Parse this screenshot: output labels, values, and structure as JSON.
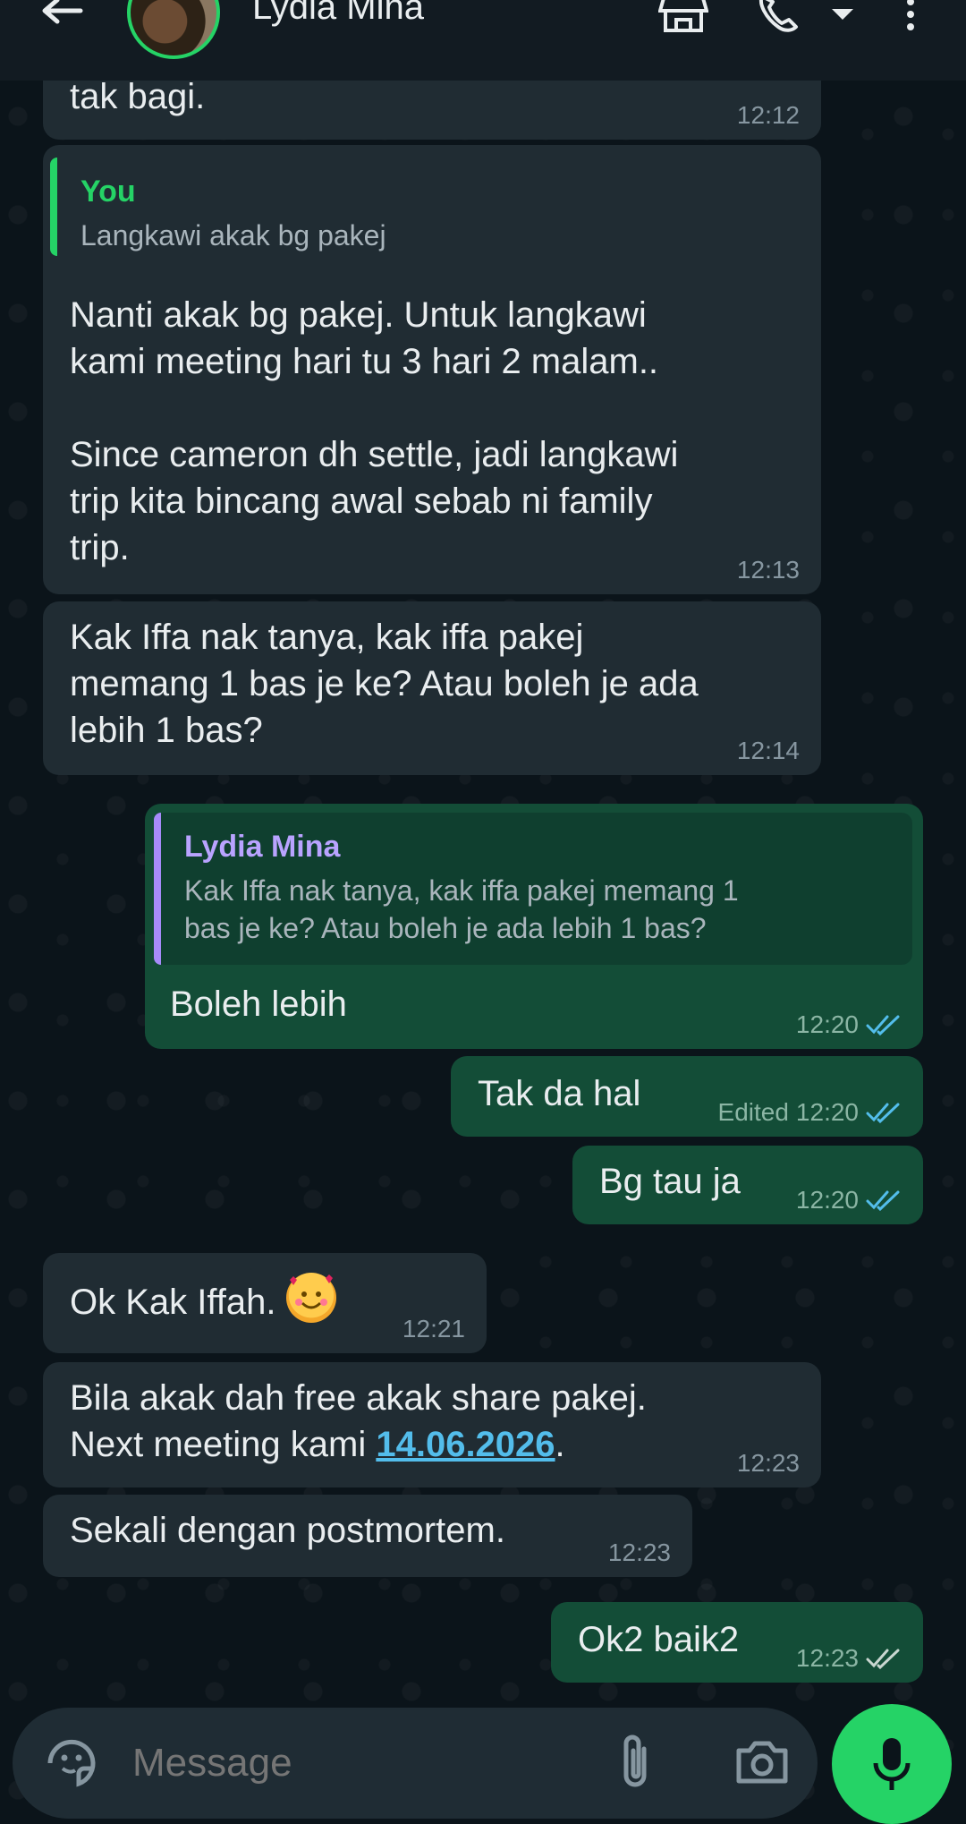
{
  "header": {
    "contact_name": "Lydia Mina"
  },
  "messages": [
    {
      "id": "m1",
      "direction": "in",
      "text": "tak bagi.",
      "time": "12:12"
    },
    {
      "id": "m2",
      "direction": "in",
      "quote": {
        "name": "You",
        "text": "Langkawi akak bg pakej"
      },
      "text": "Nanti akak bg pakej. Untuk langkawi\nkami meeting hari tu 3 hari 2 malam..\n\nSince cameron dh settle, jadi langkawi\ntrip kita bincang awal sebab ni family\ntrip.",
      "time": "12:13"
    },
    {
      "id": "m3",
      "direction": "in",
      "text": "Kak Iffa nak tanya, kak iffa pakej\nmemang 1 bas je ke? Atau boleh je ada\nlebih 1 bas?",
      "time": "12:14"
    },
    {
      "id": "m4",
      "direction": "out",
      "quote": {
        "name": "Lydia Mina",
        "text": "Kak Iffa nak tanya, kak iffa pakej memang 1\nbas je ke? Atau boleh je ada lebih 1 bas?"
      },
      "text": "Boleh lebih",
      "time": "12:20"
    },
    {
      "id": "m5",
      "direction": "out",
      "text": "Tak da hal",
      "edited": "Edited",
      "time": "12:20"
    },
    {
      "id": "m6",
      "direction": "out",
      "text": "Bg tau ja",
      "time": "12:20"
    },
    {
      "id": "m7",
      "direction": "in",
      "text": "Ok Kak Iffah.",
      "time": "12:21"
    },
    {
      "id": "m8",
      "direction": "in",
      "text_line1": "Bila akak dah free akak share pakej.",
      "text_line2_prefix": "Next meeting kami ",
      "link": "14.06.2026",
      "text_line2_suffix": ".",
      "time": "12:23"
    },
    {
      "id": "m9",
      "direction": "in",
      "text": "Sekali dengan postmortem.",
      "time": "12:23"
    },
    {
      "id": "m10",
      "direction": "out",
      "text": "Ok2 baik2",
      "time": "12:23"
    }
  ],
  "composer": {
    "placeholder": "Message"
  },
  "colors": {
    "you_quote": "#25d366",
    "contact_quote": "#a78bfa",
    "read_ticks": "#53bdeb",
    "sent_ticks": "#8bb5a4"
  }
}
